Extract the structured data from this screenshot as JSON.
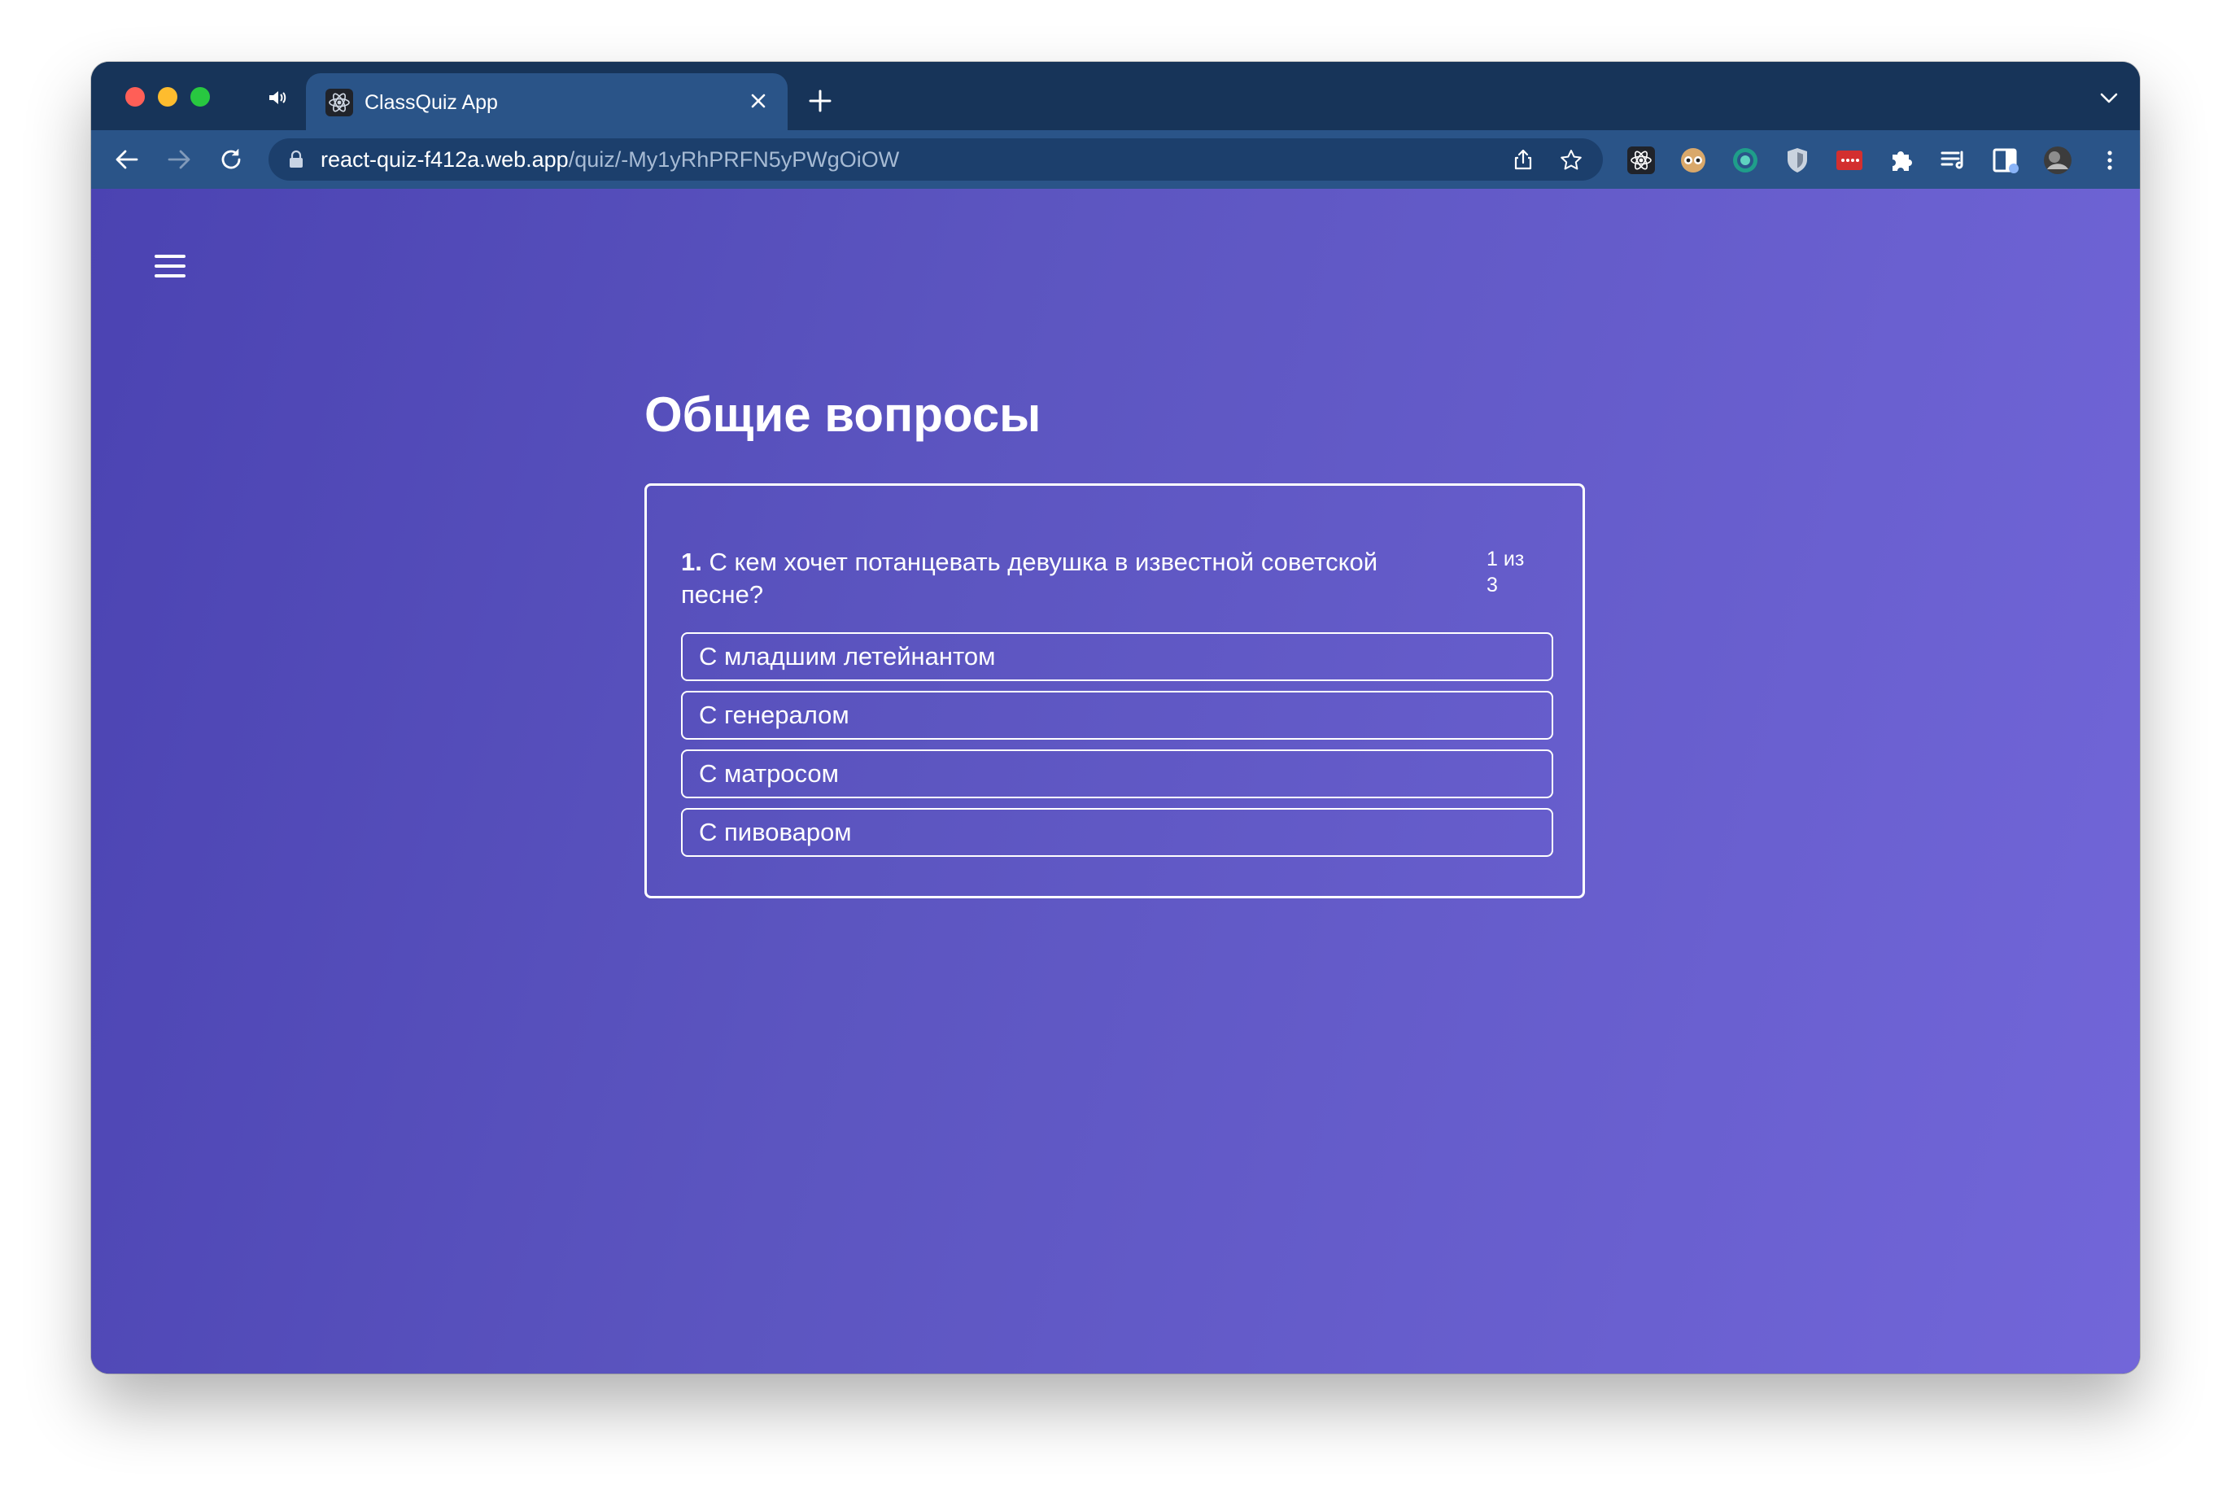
{
  "browser": {
    "tab": {
      "title": "ClassQuiz App"
    },
    "address_bar": {
      "host": "react-quiz-f412a.web.app",
      "path": "/quiz/-My1yRhPRFN5yPWgOiOW"
    },
    "extension_icons": [
      "react-devtools-icon",
      "owl-extension-icon",
      "target-extension-icon",
      "shield-extension-icon",
      "password-manager-extension-icon",
      "puzzle-icon",
      "reading-list-icon",
      "side-panel-icon",
      "profile-avatar"
    ],
    "colors": {
      "tabstrip": "#173459",
      "active_tab": "#2a5488",
      "omnibox": "#1c3f6c"
    }
  },
  "page": {
    "title": "Общие вопросы",
    "question": {
      "number": "1.",
      "text": "С кем хочет потанцевать девушка в известной советской песне?",
      "counter": "1 из 3"
    },
    "answers": [
      {
        "label": "С младшим летейнантом"
      },
      {
        "label": "С генералом"
      },
      {
        "label": "С матросом"
      },
      {
        "label": "С пивоваром"
      }
    ],
    "colors": {
      "gradient_start": "#4b43b2",
      "gradient_end": "#7266d9",
      "text": "#ffffff"
    }
  }
}
